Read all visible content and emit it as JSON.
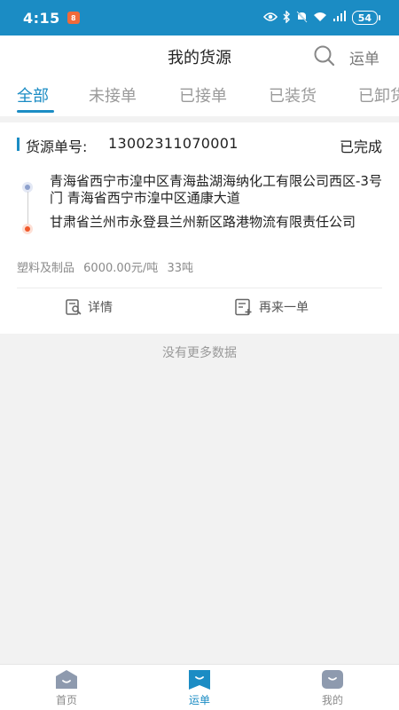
{
  "status_bar": {
    "time": "4:15",
    "badge_text": "8",
    "battery": "54"
  },
  "header": {
    "title": "我的货源",
    "right_link": "运单"
  },
  "tabs": [
    {
      "label": "全部",
      "active": true
    },
    {
      "label": "未接单"
    },
    {
      "label": "已接单"
    },
    {
      "label": "已装货"
    },
    {
      "label": "已卸货"
    }
  ],
  "order": {
    "number_label": "货源单号:",
    "number": "13002311070001",
    "status": "已完成",
    "origin": "青海省西宁市湟中区青海盐湖海纳化工有限公司西区-3号门 青海省西宁市湟中区通康大道",
    "destination": "甘肃省兰州市永登县兰州新区路港物流有限责任公司",
    "cargo_type": "塑料及制品",
    "price": "6000.00元/吨",
    "weight": "33吨",
    "actions": {
      "detail": "详情",
      "reorder": "再来一单"
    }
  },
  "list_footer": "没有更多数据",
  "bottom_nav": [
    {
      "label": "首页"
    },
    {
      "label": "运单",
      "active": true
    },
    {
      "label": "我的"
    }
  ],
  "colors": {
    "accent": "#1b8cc4",
    "origin_dot": "#8da0cc",
    "destination_dot": "#f0592b"
  }
}
